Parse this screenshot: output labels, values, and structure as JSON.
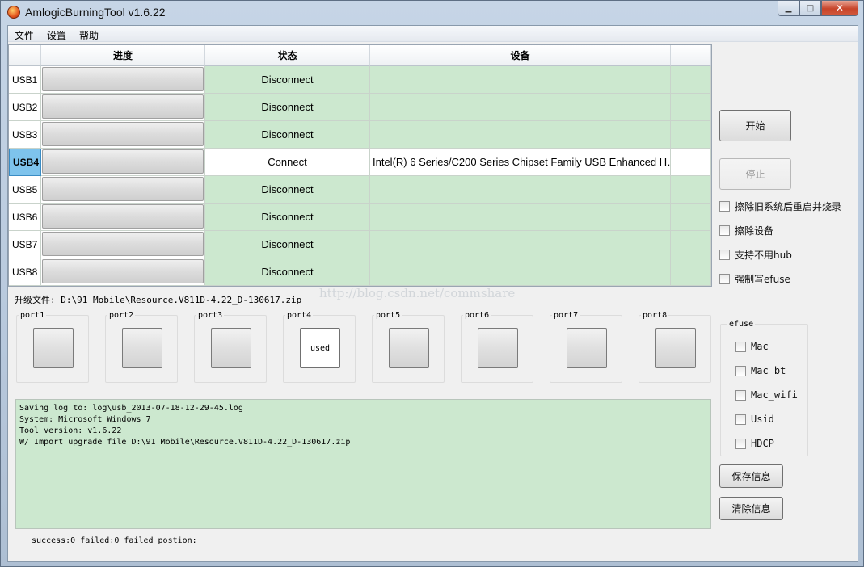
{
  "window": {
    "title": "AmlogicBurningTool  v1.6.22",
    "minimize": "▁",
    "maximize": "□",
    "close": "✕",
    "icon": "app-logo-icon"
  },
  "menu": [
    "文件",
    "设置",
    "帮助"
  ],
  "table": {
    "headers": [
      "",
      "进度",
      "状态",
      "设备",
      ""
    ],
    "rows": [
      {
        "id": "USB1",
        "status": "Disconnect",
        "device": "",
        "selected": false
      },
      {
        "id": "USB2",
        "status": "Disconnect",
        "device": "",
        "selected": false
      },
      {
        "id": "USB3",
        "status": "Disconnect",
        "device": "",
        "selected": false
      },
      {
        "id": "USB4",
        "status": "Connect",
        "device": "Intel(R) 6 Series/C200 Series Chipset Family USB Enhanced H…",
        "selected": true
      },
      {
        "id": "USB5",
        "status": "Disconnect",
        "device": "",
        "selected": false
      },
      {
        "id": "USB6",
        "status": "Disconnect",
        "device": "",
        "selected": false
      },
      {
        "id": "USB7",
        "status": "Disconnect",
        "device": "",
        "selected": false
      },
      {
        "id": "USB8",
        "status": "Disconnect",
        "device": "",
        "selected": false
      }
    ]
  },
  "controls": {
    "start_label": "开始",
    "stop_label": "停止",
    "options": [
      "擦除旧系统后重启并烧录",
      "擦除设备",
      "支持不用hub",
      "强制写efuse"
    ]
  },
  "upgrade_file": "升级文件: D:\\91 Mobile\\Resource.V811D-4.22_D-130617.zip",
  "watermark": "http://blog.csdn.net/commshare",
  "ports": [
    {
      "label": "port1",
      "text": ""
    },
    {
      "label": "port2",
      "text": ""
    },
    {
      "label": "port3",
      "text": ""
    },
    {
      "label": "port4",
      "text": "used"
    },
    {
      "label": "port5",
      "text": ""
    },
    {
      "label": "port6",
      "text": ""
    },
    {
      "label": "port7",
      "text": ""
    },
    {
      "label": "port8",
      "text": ""
    }
  ],
  "efuse": {
    "title": "efuse",
    "options": [
      "Mac",
      "Mac_bt",
      "Mac_wifi",
      "Usid",
      "HDCP"
    ]
  },
  "save_info_label": "保存信息",
  "clear_info_label": "清除信息",
  "log": [
    "Saving log to: log\\usb_2013-07-18-12-29-45.log",
    "System: Microsoft Windows 7",
    "Tool version: v1.6.22",
    "W/ Import upgrade file D:\\91 Mobile\\Resource.V811D-4.22_D-130617.zip"
  ],
  "status_line": "success:0 failed:0 failed postion:"
}
